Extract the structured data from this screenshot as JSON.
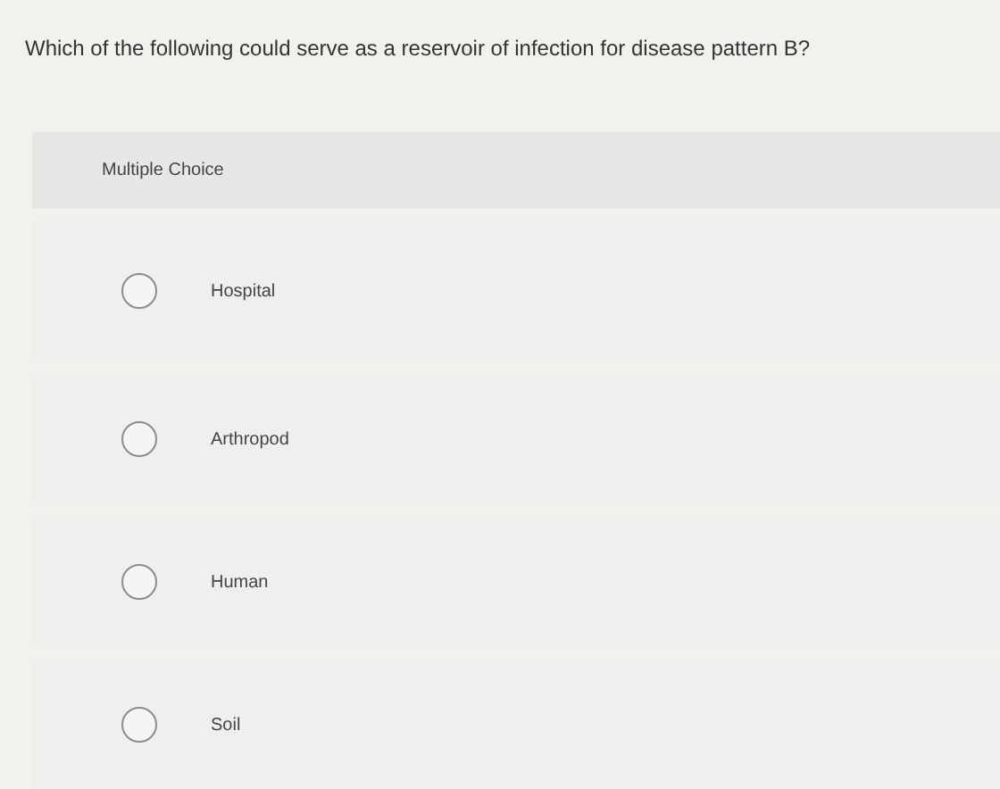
{
  "question": "Which of the following could serve as a reservoir of infection for disease pattern B?",
  "question_type": "Multiple Choice",
  "options": [
    {
      "label": "Hospital",
      "selected": false
    },
    {
      "label": "Arthropod",
      "selected": false
    },
    {
      "label": "Human",
      "selected": false
    },
    {
      "label": "Soil",
      "selected": false
    }
  ]
}
